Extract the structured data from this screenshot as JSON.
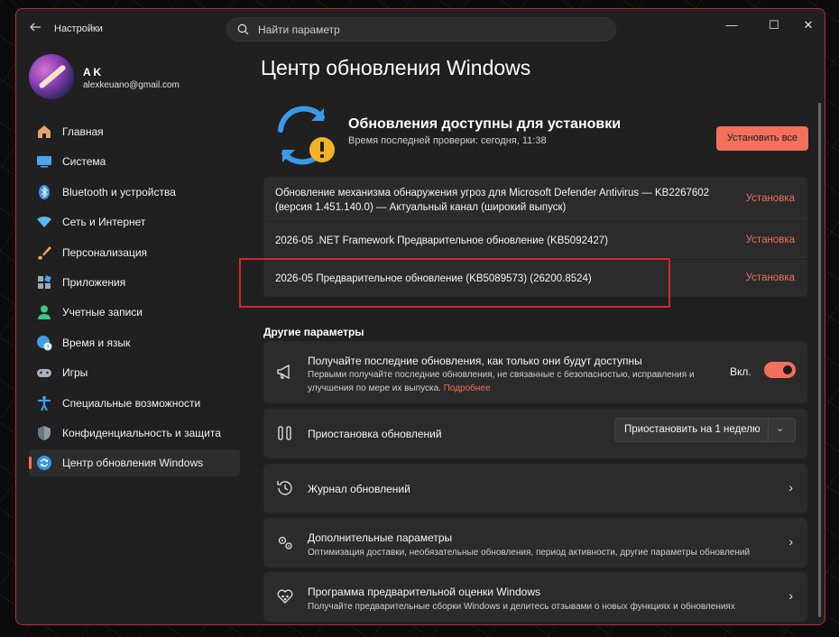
{
  "app": {
    "title": "Настройки"
  },
  "search": {
    "placeholder": "Найти параметр"
  },
  "window_controls": {
    "minimize": "—",
    "maximize": "☐",
    "close": "✕"
  },
  "profile": {
    "name": "A K",
    "email": "alexkeuano@gmail.com"
  },
  "sidebar": {
    "items": [
      {
        "label": "Главная",
        "icon": "home-icon",
        "color": "#e0a46a"
      },
      {
        "label": "Система",
        "icon": "monitor-icon",
        "color": "#4aa6e8"
      },
      {
        "label": "Bluetooth и устройства",
        "icon": "bluetooth-icon",
        "color": "#3d8ef2"
      },
      {
        "label": "Сеть и Интернет",
        "icon": "wifi-icon",
        "color": "#5bb8f5"
      },
      {
        "label": "Персонализация",
        "icon": "brush-icon",
        "color": "#f0a552"
      },
      {
        "label": "Приложения",
        "icon": "apps-icon",
        "color": "#9aa9bd"
      },
      {
        "label": "Учетные записи",
        "icon": "person-icon",
        "color": "#39c98a"
      },
      {
        "label": "Время и язык",
        "icon": "globe-clock-icon",
        "color": "#3f9ee6"
      },
      {
        "label": "Игры",
        "icon": "gamepad-icon",
        "color": "#a8b1bf"
      },
      {
        "label": "Специальные возможности",
        "icon": "accessibility-icon",
        "color": "#3ea1f1"
      },
      {
        "label": "Конфиденциальность и защита",
        "icon": "shield-icon",
        "color": "#8d98a8"
      },
      {
        "label": "Центр обновления Windows",
        "icon": "update-icon",
        "color": "#3a95e4",
        "active": true
      }
    ]
  },
  "main": {
    "title": "Центр обновления Windows",
    "status": {
      "title": "Обновления доступны для установки",
      "subtitle": "Время последней проверки: сегодня, 11:38",
      "install_all": "Установить все"
    },
    "updates": [
      {
        "name": "Обновление механизма обнаружения угроз для Microsoft Defender Antivirus — KB2267602 (версия 1.451.140.0) — Актуальный канал (широкий выпуск)",
        "action": "Установка"
      },
      {
        "name": "2026-05 .NET Framework Предварительное обновление (KB5092427)",
        "action": "Установка"
      },
      {
        "name": "2026-05 Предварительное обновление (KB5089573) (26200.8524)",
        "action": "Установка"
      }
    ],
    "other_section": "Другие параметры",
    "options": {
      "latest": {
        "title": "Получайте последние обновления, как только они будут доступны",
        "desc": "Первыми получайте последние обновления, не связанные с безопасностью, исправления и улучшения по мере их выпуска.",
        "link": "Подробнее",
        "toggle_label": "Вкл.",
        "toggle_on": true
      },
      "pause": {
        "title": "Приостановка обновлений",
        "select_value": "Приостановить на 1 неделю"
      },
      "history": {
        "title": "Журнал обновлений"
      },
      "advanced": {
        "title": "Дополнительные параметры",
        "desc": "Оптимизация доставки, необязательные обновления, период активности, другие параметры обновлений"
      },
      "insider": {
        "title": "Программа предварительной оценки Windows",
        "desc": "Получайте предварительные сборки Windows и делитесь отзывами о новых функциях и обновлениях"
      }
    }
  },
  "colors": {
    "accent": "#f2705c",
    "highlight": "#d3262c",
    "window_border": "#b2313a"
  }
}
